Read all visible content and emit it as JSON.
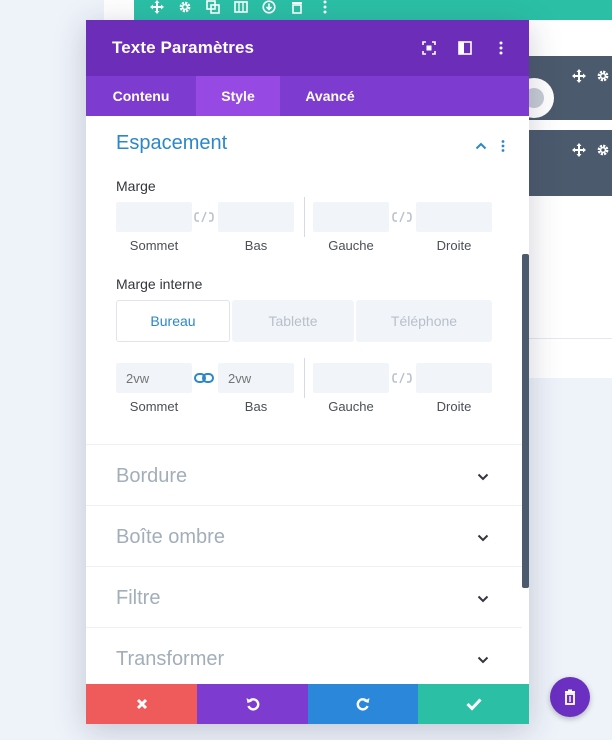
{
  "modal": {
    "title": "Texte Paramètres",
    "header_icons": [
      "expand-icon",
      "sidebar-layout-icon",
      "kebab-menu-icon"
    ],
    "tabs": [
      {
        "label": "Contenu",
        "active": false
      },
      {
        "label": "Style",
        "active": true
      },
      {
        "label": "Avancé",
        "active": false
      }
    ]
  },
  "spacing": {
    "title": "Espacement",
    "margin": {
      "label": "Marge",
      "fields": [
        {
          "label": "Sommet",
          "value": ""
        },
        {
          "label": "Bas",
          "value": ""
        },
        {
          "label": "Gauche",
          "value": ""
        },
        {
          "label": "Droite",
          "value": ""
        }
      ]
    },
    "padding": {
      "label": "Marge interne",
      "device_tabs": [
        {
          "label": "Bureau",
          "active": true
        },
        {
          "label": "Tablette",
          "active": false
        },
        {
          "label": "Téléphone",
          "active": false
        }
      ],
      "fields": [
        {
          "label": "Sommet",
          "value": "",
          "placeholder": "2vw"
        },
        {
          "label": "Bas",
          "value": "",
          "placeholder": "2vw"
        },
        {
          "label": "Gauche",
          "value": ""
        },
        {
          "label": "Droite",
          "value": ""
        }
      ]
    }
  },
  "sections": [
    {
      "title": "Bordure"
    },
    {
      "title": "Boîte ombre"
    },
    {
      "title": "Filtre"
    },
    {
      "title": "Transformer"
    }
  ],
  "footer_actions": [
    "close-icon",
    "undo-icon",
    "redo-icon",
    "check-icon"
  ],
  "colors": {
    "header": "#6c2eb9",
    "tabs": "#7e3bd0",
    "active_tab": "#9749e4",
    "accent_blue": "#2b87c9",
    "teal": "#2bc0a6",
    "red": "#ef5a5a",
    "blue": "#2b87da"
  }
}
